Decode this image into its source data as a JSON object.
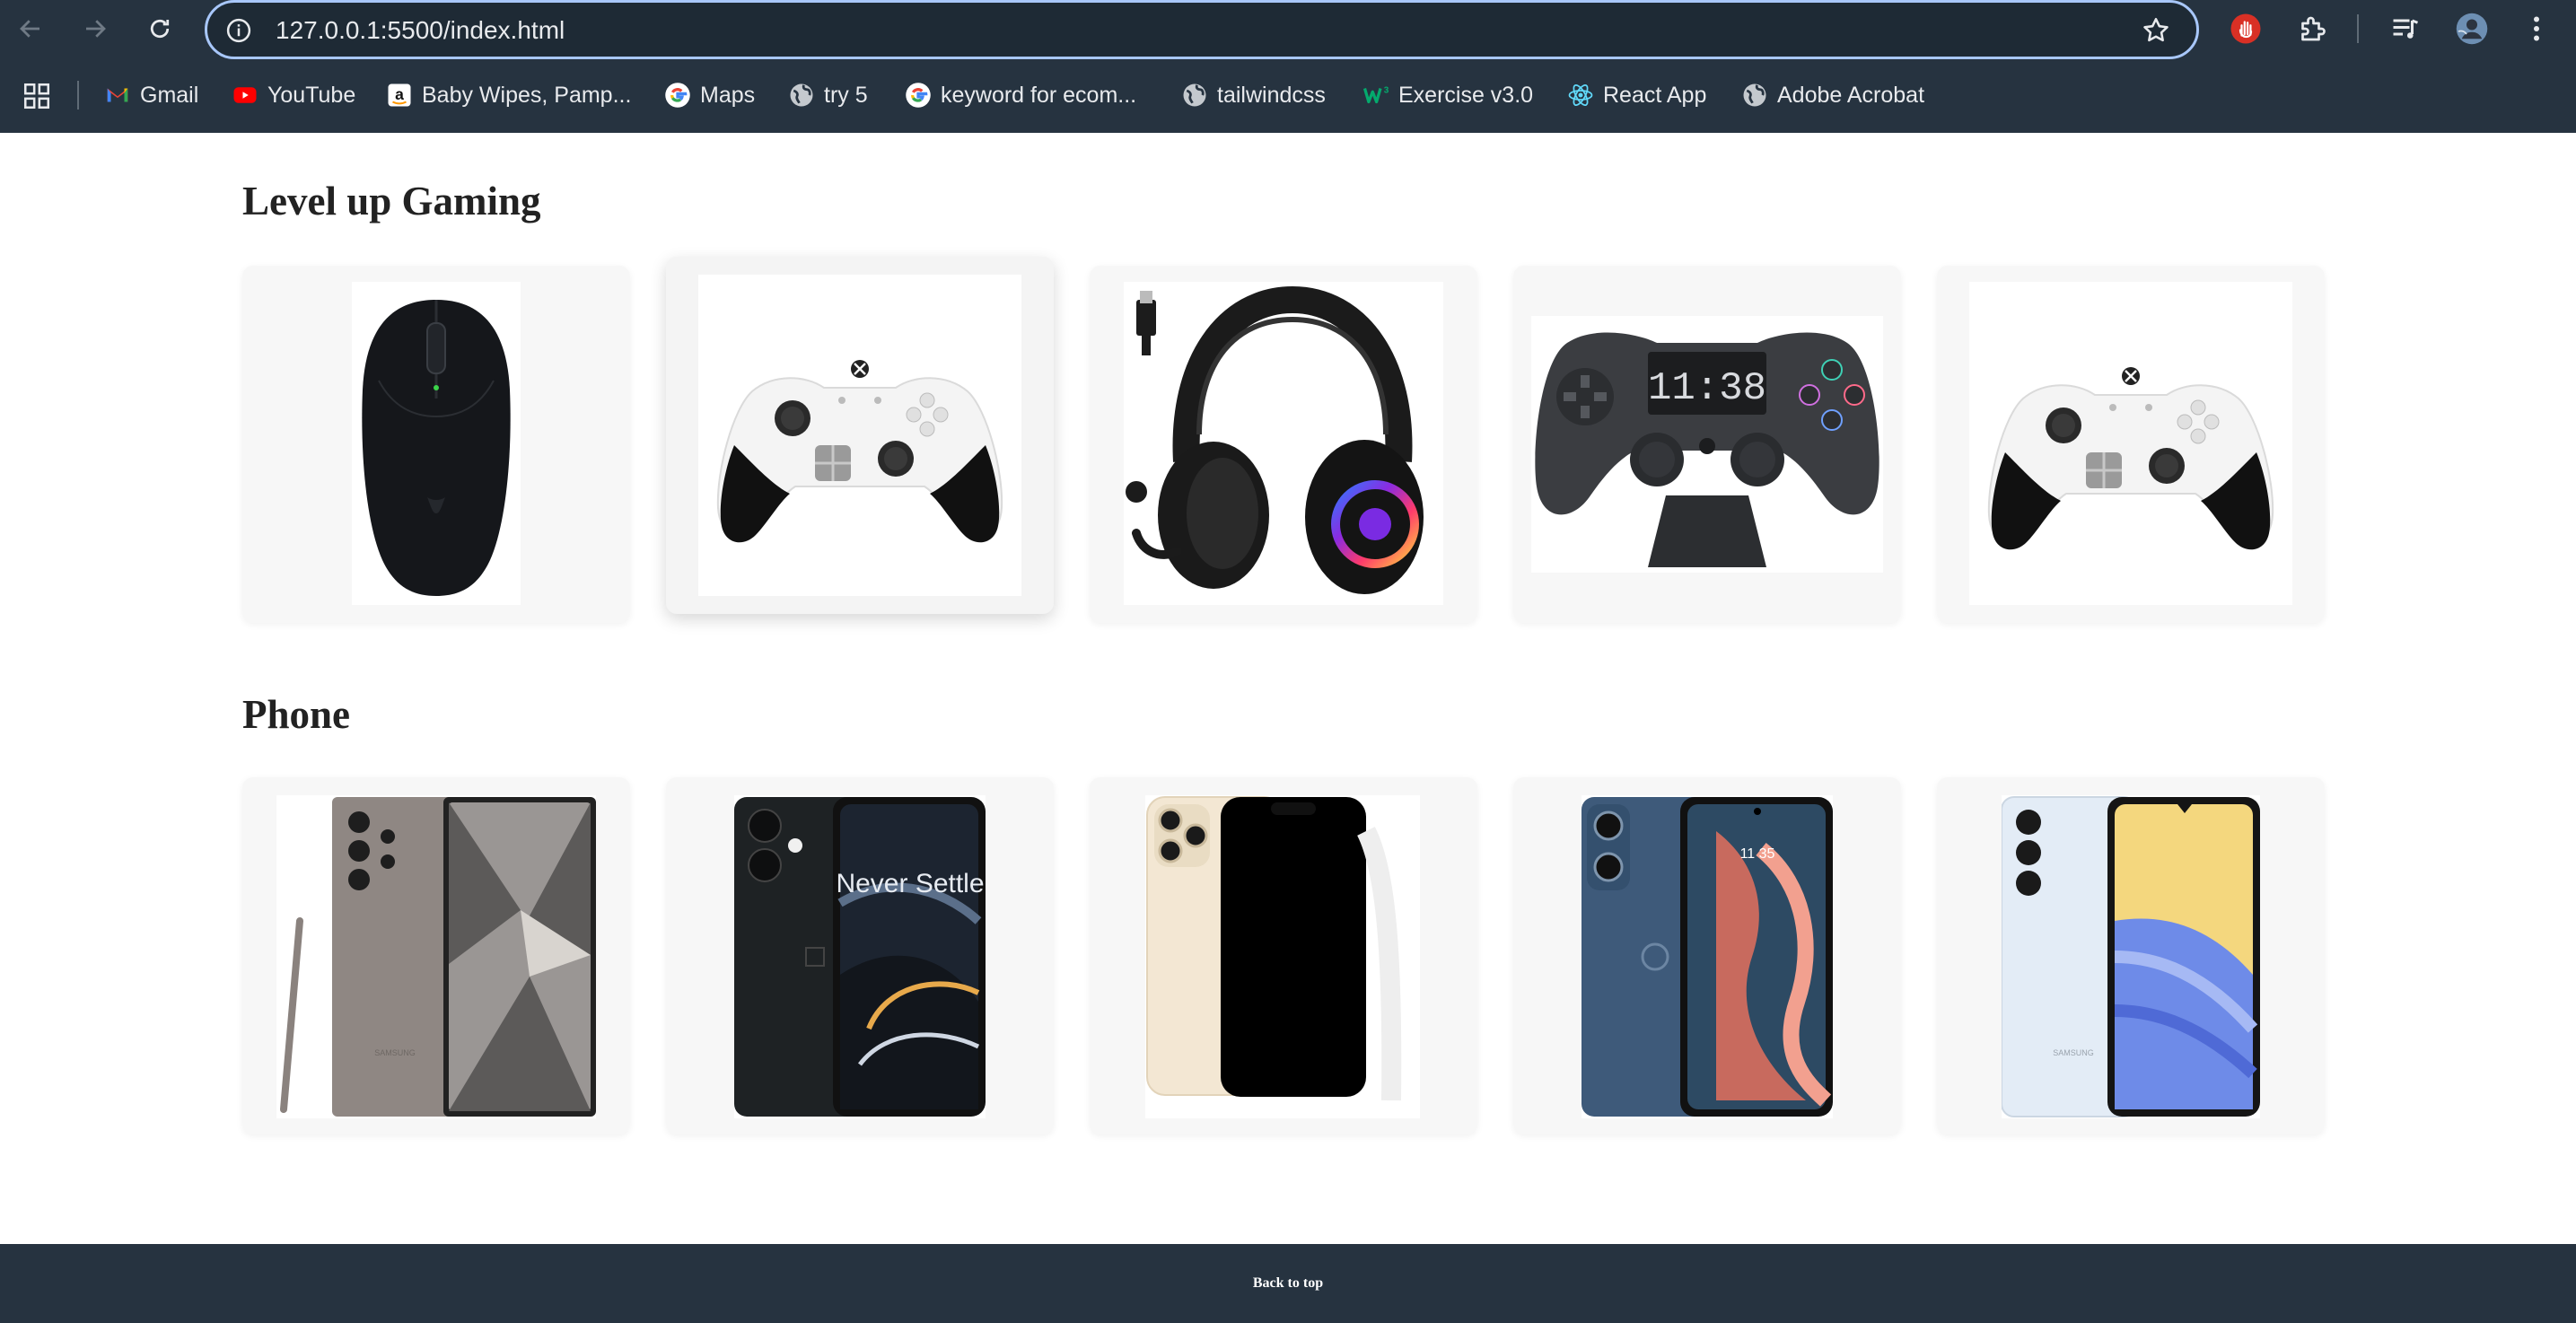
{
  "browser": {
    "url": "127.0.0.1:5500/index.html",
    "bookmarks": [
      {
        "label": "Gmail",
        "icon": "gmail-icon"
      },
      {
        "label": "YouTube",
        "icon": "youtube-icon"
      },
      {
        "label": "Baby Wipes, Pamp...",
        "icon": "amazon-icon"
      },
      {
        "label": "Maps",
        "icon": "google-icon"
      },
      {
        "label": "try 5",
        "icon": "globe-icon"
      },
      {
        "label": "keyword for ecom...",
        "icon": "google-icon"
      },
      {
        "label": "tailwindcss",
        "icon": "globe-icon"
      },
      {
        "label": "Exercise v3.0",
        "icon": "w3-icon"
      },
      {
        "label": "React App",
        "icon": "react-icon"
      },
      {
        "label": "Adobe Acrobat",
        "icon": "globe-icon"
      }
    ]
  },
  "sections": [
    {
      "title": "Level up Gaming",
      "products": [
        {
          "name": "gaming-mouse"
        },
        {
          "name": "xbox-controller-white"
        },
        {
          "name": "gaming-headset"
        },
        {
          "name": "controller-alarm-clock",
          "clock_text": "11:38"
        },
        {
          "name": "xbox-controller-white-2"
        }
      ]
    },
    {
      "title": "Phone",
      "products": [
        {
          "name": "samsung-galaxy-ultra",
          "brand": "SAMSUNG"
        },
        {
          "name": "oneplus-nord",
          "wallpaper_text": "Never Settle"
        },
        {
          "name": "iphone-gold"
        },
        {
          "name": "motorola-moto",
          "clock_text": "11 35"
        },
        {
          "name": "samsung-galaxy-a15",
          "brand": "SAMSUNG"
        }
      ]
    }
  ],
  "footer": {
    "back_to_top": "Back to top"
  },
  "colors": {
    "chrome": "#263340",
    "footer": "#263340",
    "card": "#f7f7f7",
    "focus_ring": "#a8c7fa"
  }
}
